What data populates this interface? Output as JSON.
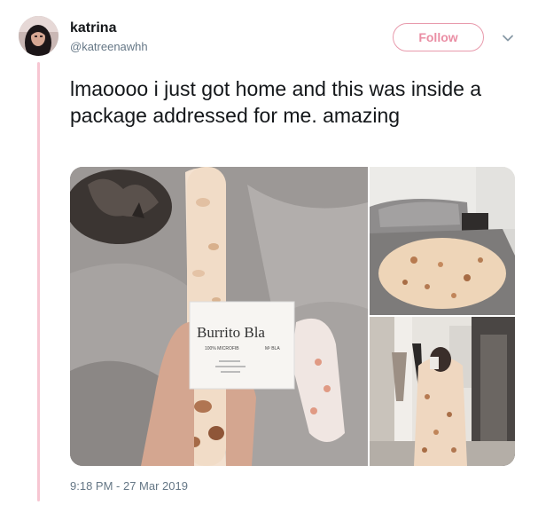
{
  "author": {
    "display_name": "katrina",
    "handle": "@katreenawhh"
  },
  "follow_button": {
    "label": "Follow"
  },
  "more_menu": {
    "icon": "chevron-down-icon"
  },
  "tweet": {
    "text": "lmaoooo i just got home and this was inside a package addressed for me. amazing",
    "timestamp": "9:18 PM - 27 Mar 2019"
  },
  "media": {
    "photos": [
      {
        "subject": "rolled-tortilla-blanket",
        "label_text": [
          "Burrito Bla",
          "100% MICROFIB",
          "M² BLA"
        ]
      },
      {
        "subject": "tortilla-blanket-on-bed"
      },
      {
        "subject": "person-wrapped-in-tortilla-blanket"
      }
    ]
  },
  "colors": {
    "accent_pink": "#ea8ea4",
    "thread_line": "#f7c6d2",
    "secondary_text": "#657786",
    "primary_text": "#14171a"
  }
}
